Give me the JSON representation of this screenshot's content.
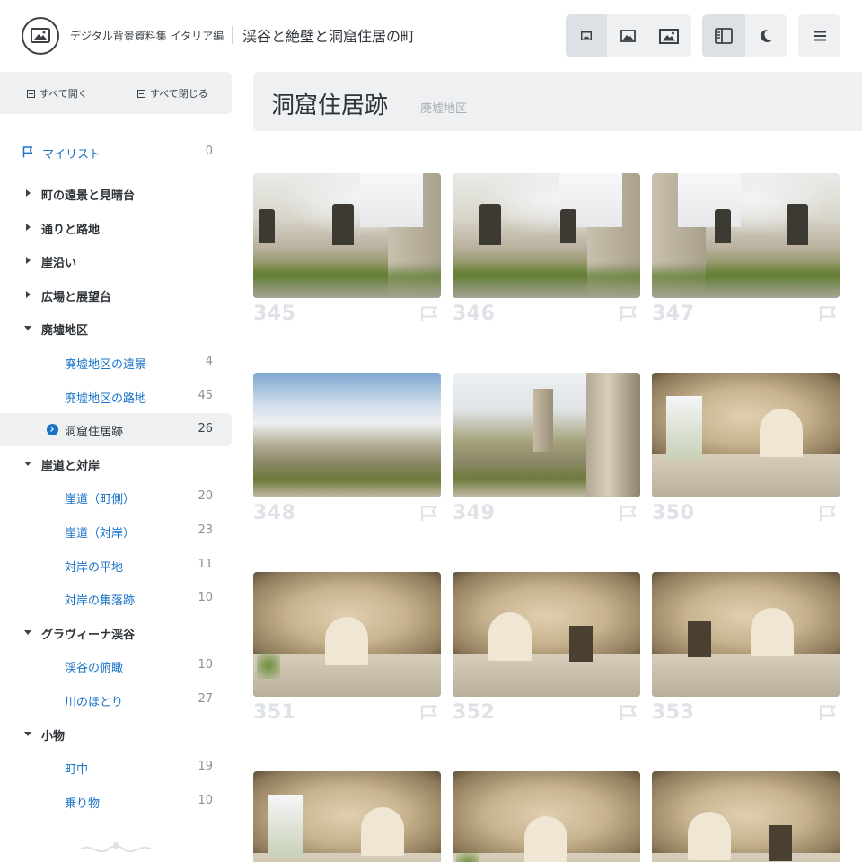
{
  "header": {
    "site_name": "デジタル背景資料集 イタリア編",
    "page_heading": "渓谷と絶壁と洞窟住居の町",
    "size_buttons": [
      "small-image-icon",
      "medium-image-icon",
      "large-image-icon"
    ],
    "view_buttons": [
      "sidebar-toggle-icon",
      "dark-mode-moon-icon"
    ],
    "menu_icon": "hamburger-menu-icon"
  },
  "sidebar": {
    "expand_all": "すべて開く",
    "collapse_all": "すべて閉じる",
    "mylist": {
      "label": "マイリスト",
      "count": "0"
    },
    "items": [
      {
        "label": "町の遠景と見晴台",
        "type": "category",
        "state": "closed"
      },
      {
        "label": "通りと路地",
        "type": "category",
        "state": "closed"
      },
      {
        "label": "崖沿い",
        "type": "category",
        "state": "closed"
      },
      {
        "label": "広場と展望台",
        "type": "category",
        "state": "closed"
      },
      {
        "label": "廃墟地区",
        "type": "category",
        "state": "open"
      },
      {
        "label": "廃墟地区の遠景",
        "count": "4",
        "type": "sub"
      },
      {
        "label": "廃墟地区の路地",
        "count": "45",
        "type": "sub"
      },
      {
        "label": "洞窟住居跡",
        "count": "26",
        "type": "sub",
        "active": true
      },
      {
        "label": "崖道と対岸",
        "type": "category",
        "state": "open"
      },
      {
        "label": "崖道（町側）",
        "count": "20",
        "type": "sub"
      },
      {
        "label": "崖道（対岸）",
        "count": "23",
        "type": "sub"
      },
      {
        "label": "対岸の平地",
        "count": "11",
        "type": "sub"
      },
      {
        "label": "対岸の集落跡",
        "count": "10",
        "type": "sub"
      },
      {
        "label": "グラヴィーナ渓谷",
        "type": "category",
        "state": "open"
      },
      {
        "label": "渓谷の俯瞰",
        "count": "10",
        "type": "sub"
      },
      {
        "label": "川のほとり",
        "count": "27",
        "type": "sub"
      },
      {
        "label": "小物",
        "type": "category",
        "state": "open"
      },
      {
        "label": "町中",
        "count": "19",
        "type": "sub"
      },
      {
        "label": "乗り物",
        "count": "10",
        "type": "sub"
      }
    ]
  },
  "main": {
    "title": "洞窟住居跡",
    "parent": "廃墟地区",
    "thumbnails": [
      {
        "number": "345",
        "scene": "alley"
      },
      {
        "number": "346",
        "scene": "alley"
      },
      {
        "number": "347",
        "scene": "alley"
      },
      {
        "number": "348",
        "scene": "view"
      },
      {
        "number": "349",
        "scene": "view"
      },
      {
        "number": "350",
        "scene": "cave"
      },
      {
        "number": "351",
        "scene": "cave"
      },
      {
        "number": "352",
        "scene": "cave"
      },
      {
        "number": "353",
        "scene": "cave"
      },
      {
        "number": "",
        "scene": "cave"
      },
      {
        "number": "",
        "scene": "cave"
      },
      {
        "number": "",
        "scene": "cave"
      }
    ]
  },
  "colors": {
    "accent": "#1a73c8",
    "panel": "#eef0f2",
    "number": "#dfe2e6"
  }
}
